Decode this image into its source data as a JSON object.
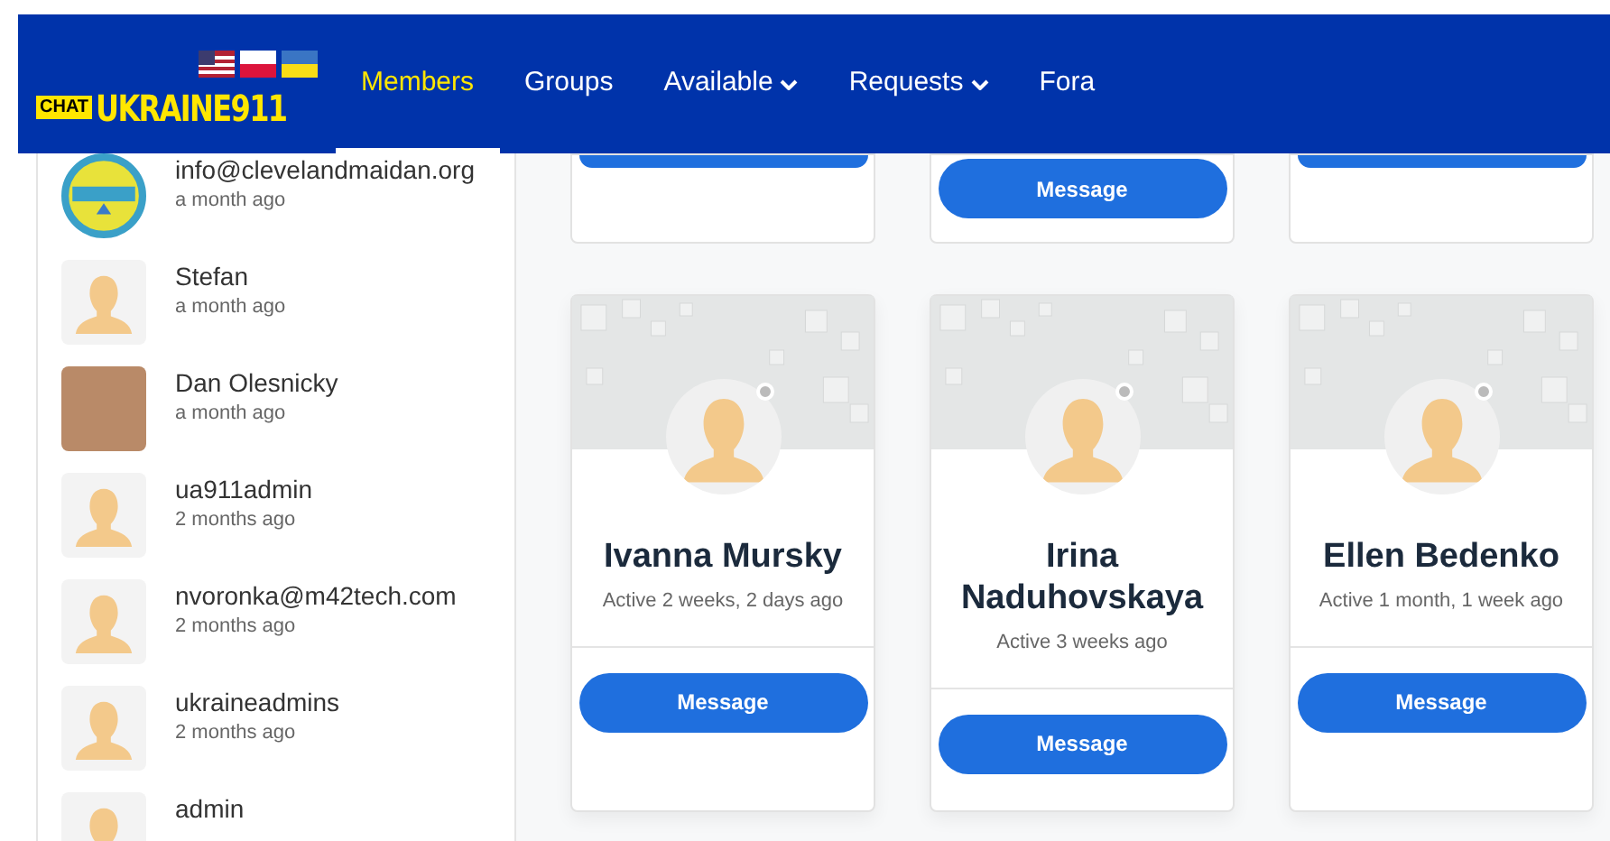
{
  "header": {
    "logo": {
      "badge": "CHAT",
      "text": "UKRAINE911"
    },
    "nav": [
      {
        "label": "Members",
        "selected": true,
        "dropdown": false
      },
      {
        "label": "Groups",
        "selected": false,
        "dropdown": false
      },
      {
        "label": "Available",
        "selected": false,
        "dropdown": true
      },
      {
        "label": "Requests",
        "selected": false,
        "dropdown": true
      },
      {
        "label": "Fora",
        "selected": false,
        "dropdown": false
      }
    ]
  },
  "sidebar": {
    "members": [
      {
        "name": "info@clevelandmaidan.org",
        "time": "a month ago",
        "kind": "logo"
      },
      {
        "name": "Stefan",
        "time": "a month ago",
        "kind": "default"
      },
      {
        "name": "Dan Olesnicky",
        "time": "a month ago",
        "kind": "photo"
      },
      {
        "name": "ua911admin",
        "time": "2 months ago",
        "kind": "default"
      },
      {
        "name": "nvoronka@m42tech.com",
        "time": "2 months ago",
        "kind": "default"
      },
      {
        "name": "ukraineadmins",
        "time": "2 months ago",
        "kind": "default"
      },
      {
        "name": "admin",
        "kind": "default"
      }
    ]
  },
  "top_cards": [
    {
      "kind": "cut"
    },
    {
      "kind": "button",
      "button": "Message"
    },
    {
      "kind": "cut"
    }
  ],
  "cards": [
    {
      "name": "Ivanna Mursky",
      "status": "Active 2 weeks, 2 days ago",
      "button": "Message",
      "online": false
    },
    {
      "name": "Irina Naduhovskaya",
      "status": "Active 3 weeks ago",
      "button": "Message",
      "online": false
    },
    {
      "name": "Ellen Bedenko",
      "status": "Active 1 month, 1 week ago",
      "button": "Message",
      "online": false
    }
  ]
}
